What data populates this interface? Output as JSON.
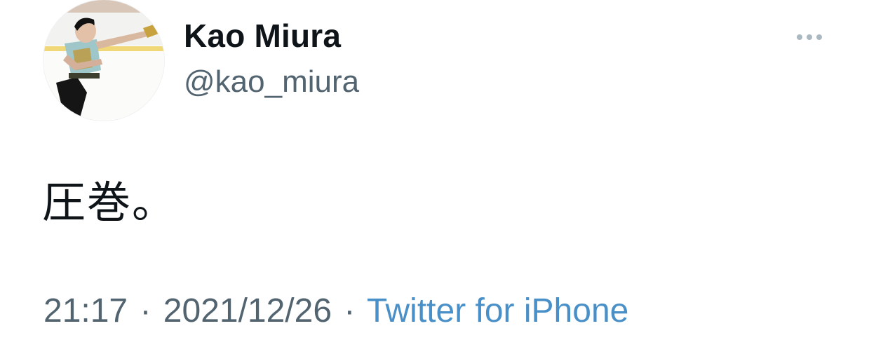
{
  "tweet": {
    "author": {
      "display_name": "Kao Miura",
      "handle": "@kao_miura"
    },
    "text": "圧巻。",
    "time": "21:17",
    "date": "2021/12/26",
    "source": "Twitter for iPhone",
    "separator": "·",
    "more_icon": "more-horizontal-icon"
  },
  "colors": {
    "text_primary": "#0f1419",
    "text_secondary": "#536471",
    "link": "#4a90c8",
    "more_dots": "#aab8c2"
  }
}
